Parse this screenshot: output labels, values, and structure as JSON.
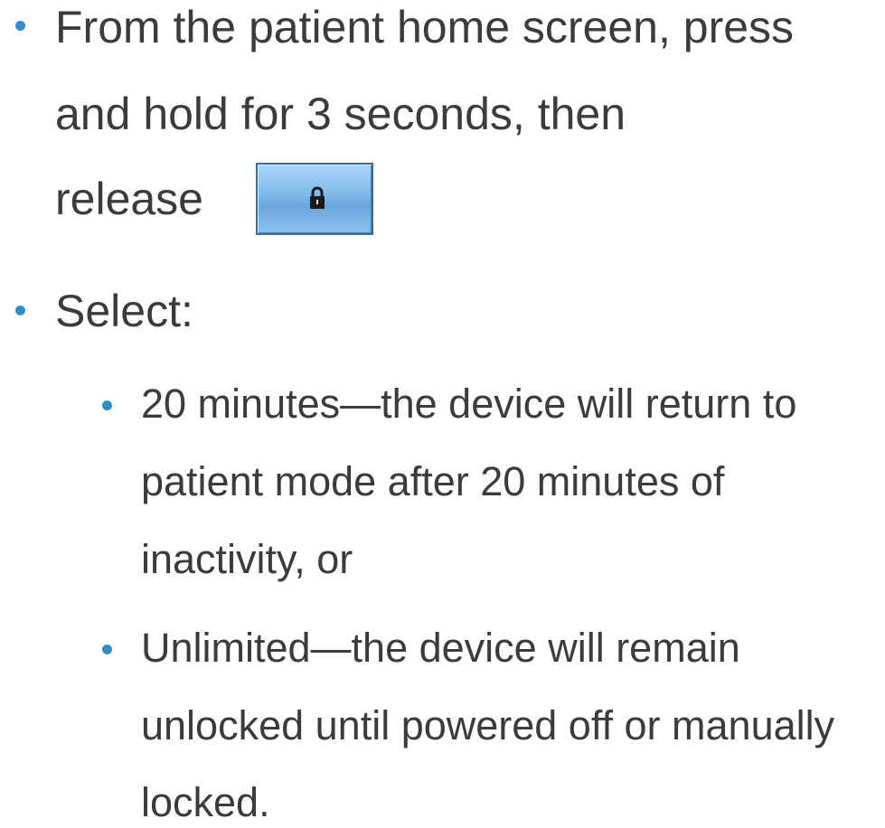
{
  "bullets": [
    {
      "lines": [
        "From the patient home screen, press",
        "and hold for 3 seconds, then",
        "release"
      ],
      "inline_button": {
        "icon": "lock-icon",
        "colors": {
          "face": "#7fb8e9",
          "border": "#3f6a92",
          "icon": "#1a1a1a"
        }
      }
    },
    {
      "lines": [
        "Select:"
      ],
      "sub_bullets": [
        {
          "lines": [
            "20 minutes—the device will return to",
            "patient mode after 20 minutes of",
            "inactivity, or"
          ]
        },
        {
          "lines": [
            "Unlimited—the device will remain",
            "unlocked until powered off or manually",
            "locked."
          ]
        }
      ]
    }
  ],
  "colors": {
    "text": "#3b3b3b",
    "bullet": "#2e8fd0",
    "background": "#ffffff"
  }
}
